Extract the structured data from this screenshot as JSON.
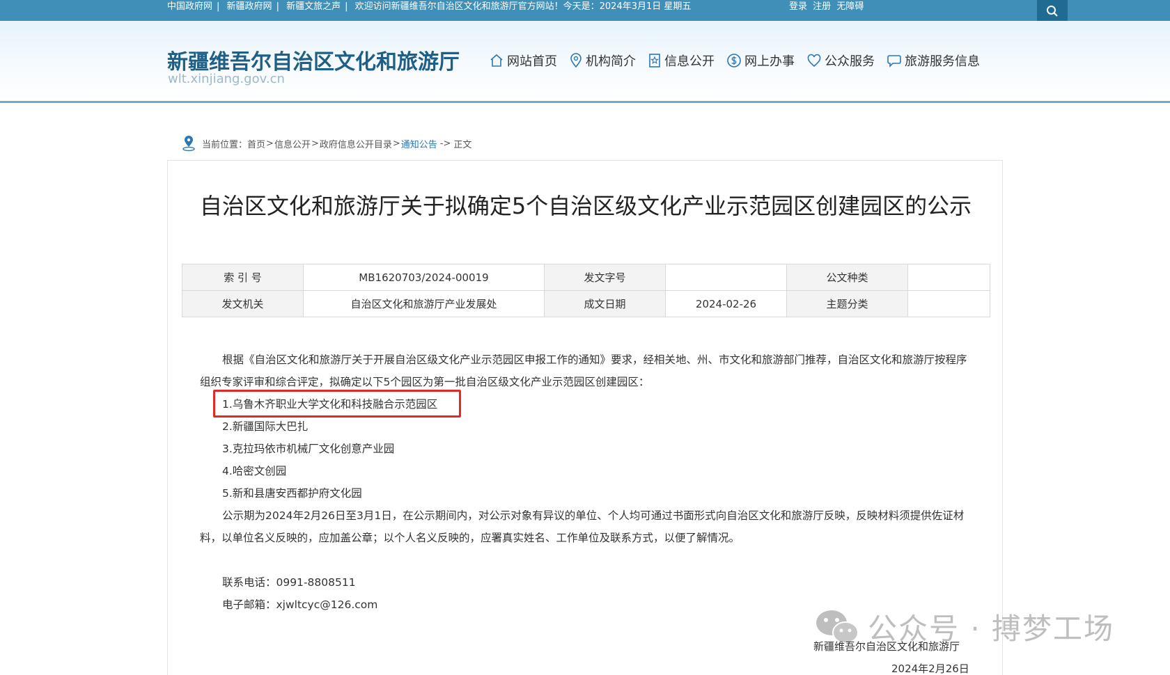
{
  "topbar": {
    "links": [
      "中国政府网",
      "新疆政府网",
      "新疆文旅之声"
    ],
    "welcome": "欢迎访问新疆维吾尔自治区文化和旅游厅官方网站！今天是：2024年3月1日  星期五",
    "login": "登录",
    "register": "注册",
    "accessibility": "无障碍",
    "search_icon": "search-icon"
  },
  "header": {
    "title": "新疆维吾尔自治区文化和旅游厅",
    "domain": "wlt.xinjiang.gov.cn",
    "nav": [
      {
        "label": "网站首页",
        "icon": "home-icon"
      },
      {
        "label": "机构简介",
        "icon": "location-pin-icon"
      },
      {
        "label": "信息公开",
        "icon": "star-doc-icon"
      },
      {
        "label": "网上办事",
        "icon": "dollar-circle-icon"
      },
      {
        "label": "公众服务",
        "icon": "heart-icon"
      },
      {
        "label": "旅游服务信息",
        "icon": "chat-bubble-icon"
      }
    ]
  },
  "breadcrumb": {
    "prefix": "当前位置：",
    "items": [
      "首页",
      "信息公开",
      "政府信息公开目录",
      "通知公告"
    ],
    "current_sep": "->",
    "current": "正文"
  },
  "article": {
    "title": "自治区文化和旅游厅关于拟确定5个自治区级文化产业示范园区创建园区的公示",
    "meta": {
      "index_label": "索 引 号",
      "index_value": "MB1620703/2024-00019",
      "doc_no_label": "发文字号",
      "doc_no_value": "",
      "doc_type_label": "公文种类",
      "doc_type_value": "",
      "issuer_label": "发文机关",
      "issuer_value": "自治区文化和旅游厅产业发展处",
      "date_label": "成文日期",
      "date_value": "2024-02-26",
      "topic_label": "主题分类",
      "topic_value": ""
    },
    "intro": "根据《自治区文化和旅游厅关于开展自治区级文化产业示范园区申报工作的通知》要求，经相关地、州、市文化和旅游部门推荐，自治区文化和旅游厅按程序组织专家评审和综合评定，拟确定以下5个园区为第一批自治区级文化产业示范园区创建园区：",
    "list": [
      "1.乌鲁木齐职业大学文化和科技融合示范园区",
      "2.新疆国际大巴扎",
      "3.克拉玛依市机械厂文化创意产业园",
      "4.哈密文创园",
      "5.新和县唐安西都护府文化园"
    ],
    "notice": "公示期为2024年2月26日至3月1日，在公示期间内，对公示对象有异议的单位、个人均可通过书面形式向自治区文化和旅游厅反映，反映材料须提供佐证材料，以单位名义反映的，应加盖公章；以个人名义反映的，应署真实姓名、工作单位及联系方式，以便了解情况。",
    "phone": "联系电话：0991-8808511",
    "email": "电子邮箱：xjwltcyc@126.com",
    "sign_org": "新疆维吾尔自治区文化和旅游厅",
    "sign_date": "2024年2月26日"
  },
  "watermark": {
    "text": "公众号 · 搏梦工场",
    "icon": "wechat-icon"
  }
}
